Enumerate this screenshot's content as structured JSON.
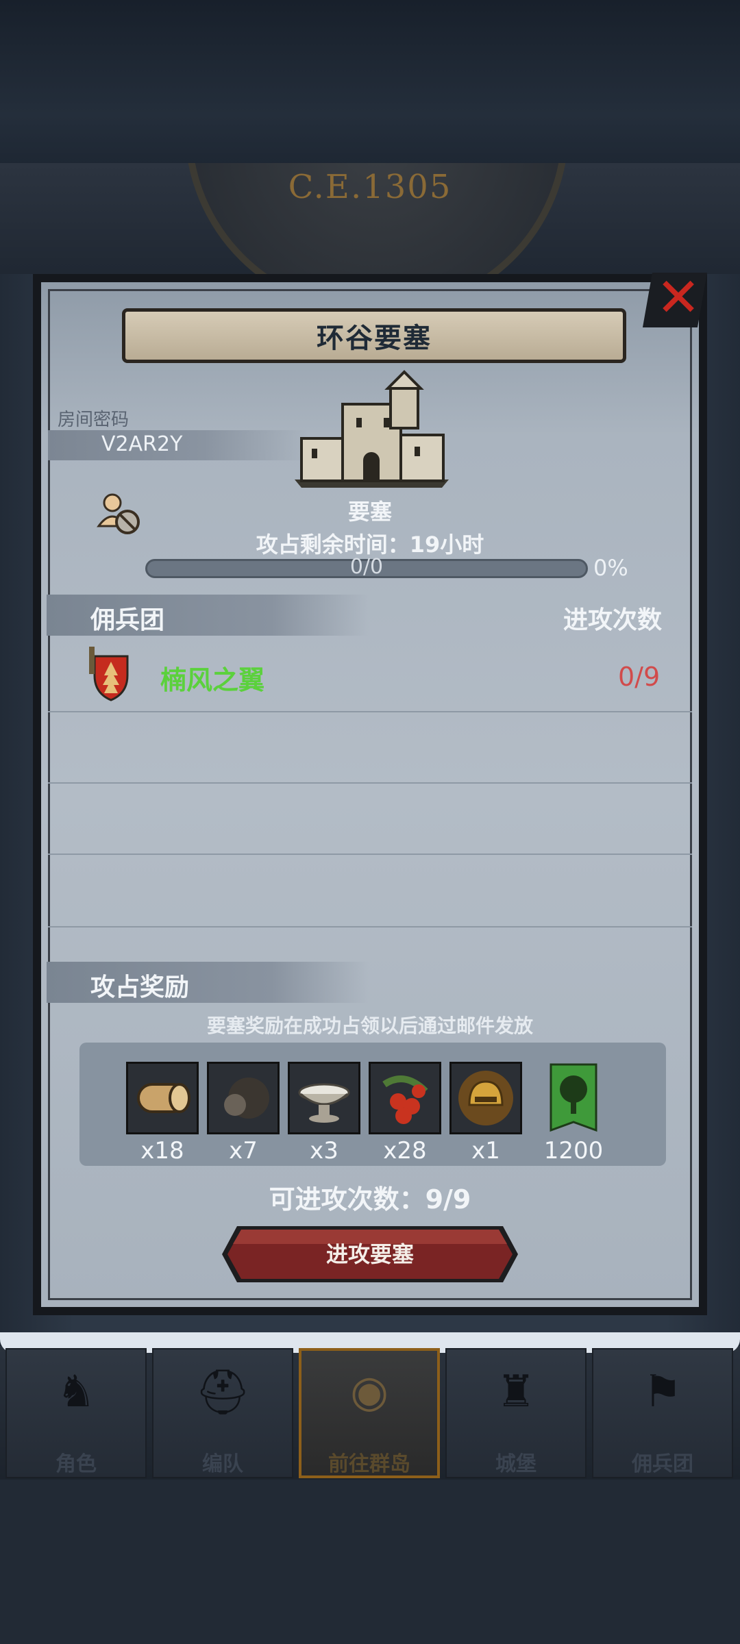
{
  "header": {
    "year": "C.E.1305"
  },
  "dialog": {
    "title": "环谷要塞",
    "close_label": "✕",
    "room_password_label": "房间密码",
    "room_password": "V2AR2Y",
    "fortress_label": "要塞",
    "time_remaining": "攻占剩余时间：19小时",
    "progress_text": "0/0",
    "progress_percent": "0%",
    "progress_value": 0,
    "mercenary_header": "佣兵团",
    "attack_count_header": "进攻次数",
    "guilds": [
      {
        "name": "楠风之翼",
        "attacks": "0/9"
      }
    ],
    "rewards_title": "攻占奖励",
    "rewards_note": "要塞奖励在成功占领以后通过邮件发放",
    "rewards": [
      {
        "icon": "wood-log-icon",
        "qty": "x18"
      },
      {
        "icon": "truffle-icon",
        "qty": "x7"
      },
      {
        "icon": "silver-bowl-icon",
        "qty": "x3"
      },
      {
        "icon": "red-berries-icon",
        "qty": "x28"
      },
      {
        "icon": "golden-helmet-icon",
        "qty": "x1"
      },
      {
        "icon": "green-tree-banner-icon",
        "qty": "1200"
      }
    ],
    "available_attacks": "可进攻次数：9/9",
    "attack_button": "进攻要塞"
  },
  "nav": {
    "items": [
      {
        "label": "角色",
        "icon": "knight-icon"
      },
      {
        "label": "编队",
        "icon": "helmet-icon"
      },
      {
        "label": "前往群岛",
        "icon": "globe-icon",
        "active": true
      },
      {
        "label": "城堡",
        "icon": "castle-icon"
      },
      {
        "label": "佣兵团",
        "icon": "banner-icon"
      }
    ]
  },
  "colors": {
    "guild_name": "#5bd13c",
    "attack_count_red": "#d14b4b",
    "close_red": "#c9271f",
    "button_red": "#7a2424"
  }
}
